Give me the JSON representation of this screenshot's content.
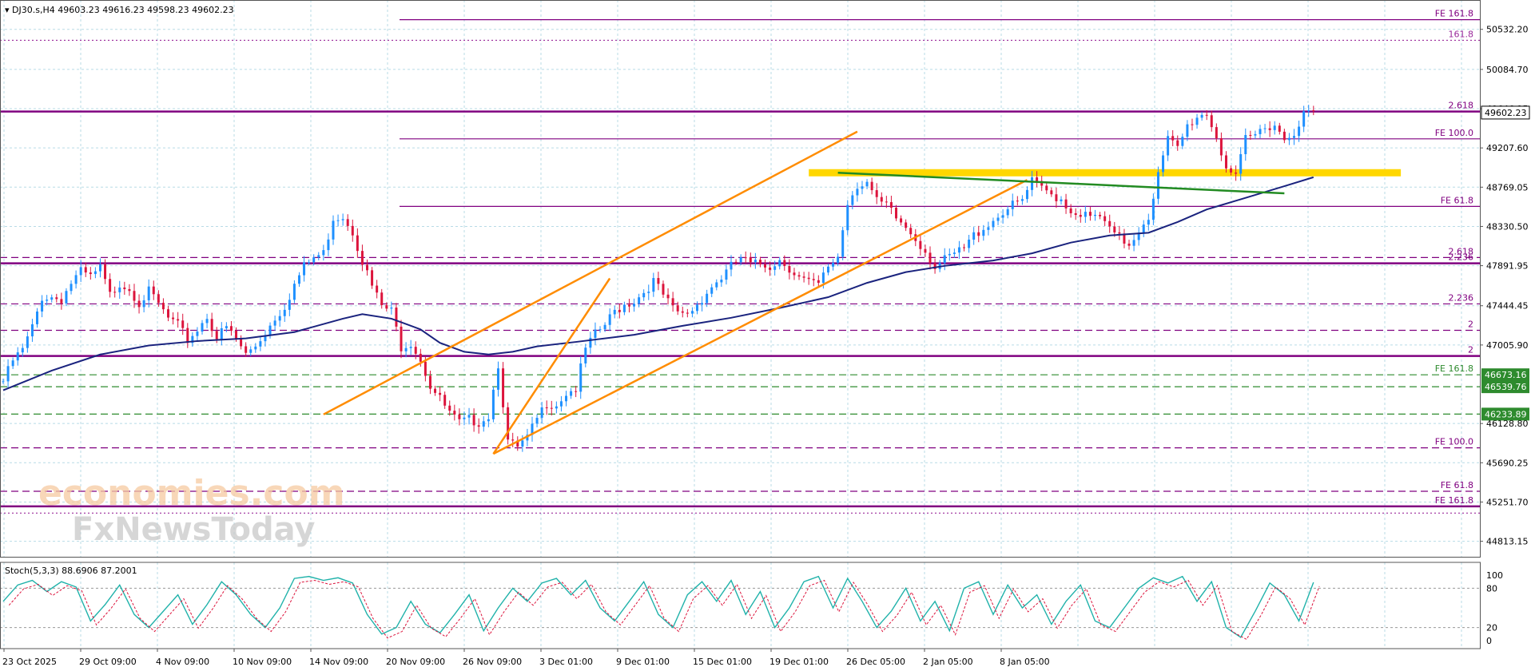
{
  "header": {
    "symbol": "DJ30.s,H4",
    "ohlc": "49603.23 49616.23 49598.23 49602.23"
  },
  "price_axis": {
    "ticks": [
      "50532.20",
      "50084.70",
      "49646.15",
      "49207.60",
      "48769.05",
      "48330.50",
      "47891.95",
      "47444.45",
      "47005.90",
      "46128.80",
      "45690.25",
      "45251.70",
      "44813.15"
    ],
    "current_price": "49602.23",
    "badges": [
      {
        "price": 46673.16,
        "label": "46673.16"
      },
      {
        "price": 46539.76,
        "label": "46539.76"
      },
      {
        "price": 46233.89,
        "label": "46233.89"
      }
    ]
  },
  "time_axis": {
    "labels": [
      "23 Oct 2025",
      "29 Oct 09:00",
      "4 Nov 09:00",
      "10 Nov 09:00",
      "14 Nov 09:00",
      "20 Nov 09:00",
      "26 Nov 09:00",
      "3 Dec 01:00",
      "9 Dec 01:00",
      "15 Dec 01:00",
      "19 Dec 01:00",
      "26 Dec 05:00",
      "2 Jan 05:00",
      "8 Jan 05:00"
    ]
  },
  "levels": [
    {
      "price": 50640,
      "label": "FE 161.8",
      "style": "solid",
      "color": "#800080"
    },
    {
      "price": 50410,
      "label": "161.8",
      "style": "dotted",
      "color": "#9b2a9b"
    },
    {
      "price": 49614,
      "label": "2.618",
      "style": "solid-thick",
      "color": "#800080"
    },
    {
      "price": 49309,
      "label": "FE 100.0",
      "style": "solid",
      "color": "#800080"
    },
    {
      "price": 48554,
      "label": "FE 61.8",
      "style": "solid",
      "color": "#800080"
    },
    {
      "price": 47983,
      "label": "2.618",
      "style": "dashed",
      "color": "#800080"
    },
    {
      "price": 47918,
      "label": "2.236",
      "style": "solid-thick",
      "color": "#800080"
    },
    {
      "price": 47465,
      "label": "2.236",
      "style": "dashed",
      "color": "#800080"
    },
    {
      "price": 47170,
      "label": "2",
      "style": "dashed",
      "color": "#800080"
    },
    {
      "price": 46883,
      "label": "2",
      "style": "solid-thick",
      "color": "#800080"
    },
    {
      "price": 46673.16,
      "label": "FE 161.8",
      "style": "dashed",
      "color": "#2e8b2e"
    },
    {
      "price": 46539.76,
      "label": "",
      "style": "dashed",
      "color": "#2e8b2e"
    },
    {
      "price": 46233.89,
      "label": "",
      "style": "dashed",
      "color": "#2e8b2e"
    },
    {
      "price": 45857,
      "label": "FE 100.0",
      "style": "dashed",
      "color": "#800080"
    },
    {
      "price": 45372,
      "label": "FE 61.8",
      "style": "dashed",
      "color": "#800080"
    },
    {
      "price": 45203,
      "label": "FE 161.8",
      "style": "solid-thick",
      "color": "#800080"
    },
    {
      "price": 45128,
      "label": "",
      "style": "dotted",
      "color": "#9b2a9b"
    }
  ],
  "chart_data": {
    "type": "candlestick",
    "instrument": "DJ30.s",
    "timeframe": "H4",
    "price_range": [
      44640,
      50860
    ],
    "close_path": [
      [
        0,
        46600
      ],
      [
        2,
        46830
      ],
      [
        4,
        46950
      ],
      [
        6,
        47200
      ],
      [
        8,
        47540
      ],
      [
        10,
        47540
      ],
      [
        12,
        47520
      ],
      [
        14,
        47700
      ],
      [
        16,
        47820
      ],
      [
        18,
        47760
      ],
      [
        20,
        47860
      ],
      [
        22,
        47560
      ],
      [
        24,
        47700
      ],
      [
        26,
        47640
      ],
      [
        28,
        47480
      ],
      [
        30,
        47600
      ],
      [
        32,
        47460
      ],
      [
        34,
        47300
      ],
      [
        36,
        47220
      ],
      [
        38,
        47060
      ],
      [
        40,
        47180
      ],
      [
        42,
        47330
      ],
      [
        44,
        47090
      ],
      [
        46,
        47200
      ],
      [
        48,
        47070
      ],
      [
        50,
        46900
      ],
      [
        52,
        47000
      ],
      [
        54,
        47150
      ],
      [
        56,
        47310
      ],
      [
        58,
        47440
      ],
      [
        60,
        47680
      ],
      [
        62,
        47880
      ],
      [
        64,
        47980
      ],
      [
        66,
        48030
      ],
      [
        68,
        48430
      ],
      [
        70,
        48450
      ],
      [
        72,
        48280
      ],
      [
        74,
        47950
      ],
      [
        76,
        47660
      ],
      [
        78,
        47440
      ],
      [
        80,
        47380
      ],
      [
        82,
        46990
      ],
      [
        84,
        47040
      ],
      [
        86,
        46850
      ],
      [
        88,
        46550
      ],
      [
        90,
        46400
      ],
      [
        92,
        46240
      ],
      [
        94,
        46130
      ],
      [
        96,
        46170
      ],
      [
        98,
        46150
      ],
      [
        100,
        46220
      ],
      [
        102,
        46800
      ],
      [
        104,
        45920
      ],
      [
        106,
        45850
      ],
      [
        108,
        45960
      ],
      [
        110,
        46180
      ],
      [
        112,
        46360
      ],
      [
        114,
        46350
      ],
      [
        116,
        46470
      ],
      [
        118,
        46520
      ],
      [
        120,
        46960
      ],
      [
        122,
        47120
      ],
      [
        124,
        47230
      ],
      [
        126,
        47380
      ],
      [
        128,
        47460
      ],
      [
        130,
        47500
      ],
      [
        132,
        47600
      ],
      [
        134,
        47720
      ],
      [
        136,
        47560
      ],
      [
        138,
        47400
      ],
      [
        140,
        47340
      ],
      [
        142,
        47400
      ],
      [
        144,
        47530
      ],
      [
        146,
        47660
      ],
      [
        148,
        47760
      ],
      [
        150,
        47880
      ],
      [
        152,
        47980
      ],
      [
        154,
        47900
      ],
      [
        156,
        47910
      ],
      [
        158,
        47890
      ],
      [
        160,
        47960
      ],
      [
        162,
        47870
      ],
      [
        164,
        47760
      ],
      [
        166,
        47700
      ],
      [
        168,
        47670
      ],
      [
        170,
        47880
      ],
      [
        172,
        48000
      ],
      [
        174,
        48600
      ],
      [
        176,
        48800
      ],
      [
        178,
        48830
      ],
      [
        180,
        48600
      ],
      [
        182,
        48560
      ],
      [
        184,
        48420
      ],
      [
        186,
        48320
      ],
      [
        188,
        48200
      ],
      [
        190,
        48060
      ],
      [
        192,
        47880
      ],
      [
        194,
        47950
      ],
      [
        196,
        48020
      ],
      [
        198,
        48080
      ],
      [
        200,
        48230
      ],
      [
        202,
        48320
      ],
      [
        204,
        48400
      ],
      [
        206,
        48500
      ],
      [
        208,
        48560
      ],
      [
        210,
        48620
      ],
      [
        212,
        48830
      ],
      [
        214,
        48750
      ],
      [
        216,
        48690
      ],
      [
        218,
        48640
      ],
      [
        220,
        48500
      ],
      [
        222,
        48480
      ],
      [
        224,
        48420
      ],
      [
        226,
        48440
      ],
      [
        228,
        48280
      ],
      [
        230,
        48200
      ],
      [
        232,
        48130
      ],
      [
        234,
        48300
      ],
      [
        236,
        48450
      ],
      [
        238,
        48900
      ],
      [
        240,
        49300
      ],
      [
        242,
        49200
      ],
      [
        244,
        49450
      ],
      [
        246,
        49560
      ],
      [
        248,
        49600
      ],
      [
        250,
        49330
      ],
      [
        252,
        49000
      ],
      [
        254,
        48860
      ],
      [
        256,
        49300
      ],
      [
        258,
        49350
      ],
      [
        260,
        49450
      ],
      [
        262,
        49480
      ],
      [
        264,
        49300
      ],
      [
        266,
        49400
      ],
      [
        268,
        49580
      ],
      [
        270,
        49600
      ]
    ],
    "moving_average": [
      [
        0,
        46500
      ],
      [
        10,
        46720
      ],
      [
        20,
        46900
      ],
      [
        30,
        47000
      ],
      [
        40,
        47050
      ],
      [
        50,
        47080
      ],
      [
        60,
        47150
      ],
      [
        70,
        47300
      ],
      [
        74,
        47350
      ],
      [
        80,
        47300
      ],
      [
        86,
        47180
      ],
      [
        90,
        47030
      ],
      [
        95,
        46930
      ],
      [
        100,
        46900
      ],
      [
        105,
        46930
      ],
      [
        110,
        46990
      ],
      [
        118,
        47040
      ],
      [
        130,
        47120
      ],
      [
        140,
        47220
      ],
      [
        150,
        47310
      ],
      [
        160,
        47420
      ],
      [
        170,
        47540
      ],
      [
        178,
        47700
      ],
      [
        186,
        47820
      ],
      [
        194,
        47890
      ],
      [
        204,
        47950
      ],
      [
        212,
        48030
      ],
      [
        220,
        48150
      ],
      [
        228,
        48230
      ],
      [
        236,
        48260
      ],
      [
        242,
        48380
      ],
      [
        248,
        48520
      ],
      [
        256,
        48650
      ],
      [
        264,
        48780
      ],
      [
        270,
        48880
      ]
    ],
    "trendlines": [
      {
        "color": "#ff8c00",
        "from": [
          66,
          46230
        ],
        "to": [
          176,
          49390
        ]
      },
      {
        "color": "#ff8c00",
        "from": [
          101,
          45790
        ],
        "to": [
          211,
          48850
        ]
      },
      {
        "color": "#ff8c00",
        "from": [
          101,
          45790
        ],
        "to": [
          125,
          47750
        ]
      },
      {
        "color": "#228b22",
        "from": [
          172,
          48930
        ],
        "to": [
          264,
          48700
        ]
      }
    ],
    "zones": [
      {
        "color": "#ffd700",
        "from": [
          166,
          48930
        ],
        "to": [
          288,
          48930
        ]
      }
    ],
    "stochastic": {
      "label": "Stoch(5,3,3) 88.6906 87.2001",
      "k": 88.6906,
      "d": 87.2001,
      "levels": [
        80,
        20
      ],
      "axis_labels": [
        "100",
        "80",
        "20",
        "0"
      ],
      "path": [
        [
          0,
          60
        ],
        [
          3,
          85
        ],
        [
          6,
          92
        ],
        [
          9,
          75
        ],
        [
          12,
          90
        ],
        [
          15,
          82
        ],
        [
          18,
          30
        ],
        [
          21,
          55
        ],
        [
          24,
          85
        ],
        [
          27,
          40
        ],
        [
          30,
          20
        ],
        [
          33,
          45
        ],
        [
          36,
          70
        ],
        [
          39,
          25
        ],
        [
          42,
          55
        ],
        [
          45,
          90
        ],
        [
          48,
          70
        ],
        [
          51,
          40
        ],
        [
          54,
          20
        ],
        [
          57,
          50
        ],
        [
          60,
          95
        ],
        [
          63,
          98
        ],
        [
          66,
          92
        ],
        [
          69,
          96
        ],
        [
          72,
          88
        ],
        [
          75,
          40
        ],
        [
          78,
          10
        ],
        [
          81,
          20
        ],
        [
          84,
          60
        ],
        [
          87,
          25
        ],
        [
          90,
          12
        ],
        [
          93,
          40
        ],
        [
          96,
          70
        ],
        [
          99,
          15
        ],
        [
          102,
          50
        ],
        [
          105,
          80
        ],
        [
          108,
          60
        ],
        [
          111,
          88
        ],
        [
          114,
          95
        ],
        [
          117,
          70
        ],
        [
          120,
          92
        ],
        [
          123,
          50
        ],
        [
          126,
          30
        ],
        [
          129,
          60
        ],
        [
          132,
          90
        ],
        [
          135,
          40
        ],
        [
          138,
          20
        ],
        [
          141,
          70
        ],
        [
          144,
          90
        ],
        [
          147,
          60
        ],
        [
          150,
          92
        ],
        [
          153,
          40
        ],
        [
          156,
          75
        ],
        [
          159,
          20
        ],
        [
          162,
          50
        ],
        [
          165,
          90
        ],
        [
          168,
          98
        ],
        [
          171,
          50
        ],
        [
          174,
          95
        ],
        [
          177,
          60
        ],
        [
          180,
          20
        ],
        [
          183,
          45
        ],
        [
          186,
          80
        ],
        [
          189,
          30
        ],
        [
          192,
          60
        ],
        [
          195,
          15
        ],
        [
          198,
          80
        ],
        [
          201,
          90
        ],
        [
          204,
          40
        ],
        [
          207,
          85
        ],
        [
          210,
          50
        ],
        [
          213,
          70
        ],
        [
          216,
          25
        ],
        [
          219,
          60
        ],
        [
          222,
          85
        ],
        [
          225,
          30
        ],
        [
          228,
          20
        ],
        [
          231,
          50
        ],
        [
          234,
          80
        ],
        [
          237,
          96
        ],
        [
          240,
          88
        ],
        [
          243,
          98
        ],
        [
          246,
          60
        ],
        [
          249,
          90
        ],
        [
          252,
          20
        ],
        [
          255,
          5
        ],
        [
          258,
          45
        ],
        [
          261,
          88
        ],
        [
          264,
          70
        ],
        [
          267,
          30
        ],
        [
          270,
          89
        ]
      ]
    }
  },
  "watermark": {
    "line1": "economies.com",
    "line2": "FxNewsToday"
  },
  "colors": {
    "candle_up": "#1e90ff",
    "candle_down": "#dc143c",
    "grid": "#b8dbe6",
    "stoch_main": "#20b2aa",
    "stoch_signal": "#dc143c",
    "ma": "#1a237e"
  }
}
